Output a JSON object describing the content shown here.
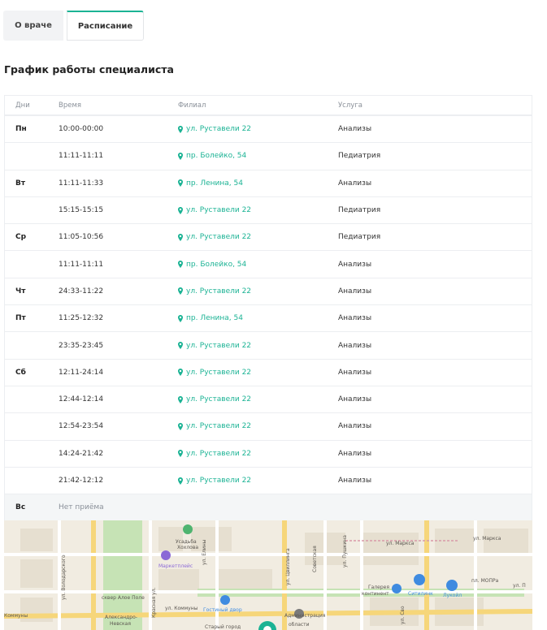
{
  "tabs": {
    "about": "О враче",
    "schedule": "Расписание"
  },
  "section_title": "График работы специалиста",
  "table": {
    "headers": {
      "day": "Дни",
      "time": "Время",
      "branch": "Филиал",
      "service": "Услуга"
    },
    "rows": [
      {
        "day": "Пн",
        "time": "10:00-00:00",
        "branch": "ул. Руставели 22",
        "service": "Анализы"
      },
      {
        "day": "",
        "time": "11:11-11:11",
        "branch": "пр. Болейко, 54",
        "service": "Педиатрия"
      },
      {
        "day": "Вт",
        "time": "11:11-11:33",
        "branch": "пр. Ленина, 54",
        "service": "Анализы"
      },
      {
        "day": "",
        "time": "15:15-15:15",
        "branch": "ул. Руставели 22",
        "service": "Педиатрия"
      },
      {
        "day": "Ср",
        "time": "11:05-10:56",
        "branch": "ул. Руставели 22",
        "service": "Педиатрия"
      },
      {
        "day": "",
        "time": "11:11-11:11",
        "branch": "пр. Болейко, 54",
        "service": "Анализы"
      },
      {
        "day": "Чт",
        "time": "24:33-11:22",
        "branch": "ул. Руставели 22",
        "service": "Анализы"
      },
      {
        "day": "Пт",
        "time": "11:25-12:32",
        "branch": "пр. Ленина, 54",
        "service": "Анализы"
      },
      {
        "day": "",
        "time": "23:35-23:45",
        "branch": "ул. Руставели 22",
        "service": "Анализы"
      },
      {
        "day": "Сб",
        "time": "12:11-24:14",
        "branch": "ул. Руставели 22",
        "service": "Анализы"
      },
      {
        "day": "",
        "time": "12:44-12:14",
        "branch": "ул. Руставели 22",
        "service": "Анализы"
      },
      {
        "day": "",
        "time": "12:54-23:54",
        "branch": "ул. Руставели 22",
        "service": "Анализы"
      },
      {
        "day": "",
        "time": "14:24-21:42",
        "branch": "ул. Руставели 22",
        "service": "Анализы"
      },
      {
        "day": "",
        "time": "21:42-12:12",
        "branch": "ул. Руставели 22",
        "service": "Анализы"
      }
    ],
    "empty_day": {
      "day": "Вс",
      "text": "Нет приёма"
    }
  },
  "map": {
    "labels": {
      "usadba": "Усадьба",
      "khokhlova": "Хохлова",
      "marketplace": "Маркетплейс",
      "ul_eliny": "ул. Елины",
      "ul_tsvillinga": "ул. Цвиллинга",
      "sovetskaya": "Советская",
      "ul_pushkina": "ул. Пушкина",
      "ul_marksa": "ул. Маркса",
      "ul_marksa_2": "ул. Маркса",
      "ul_tsvetkov": "ул. Цвиллинга",
      "ul_volodarskogo": "ул. Володарского",
      "skver": "сквер Алое Поле",
      "krasnaya": "Красная ул.",
      "kommuny": "ул. Коммуны",
      "gostiny": "Гостиный двор",
      "galereya": "Галерея",
      "kontinent": "континент",
      "citilink": "Ситилинк",
      "lukoil": "Лукойл",
      "mopra": "пл. МОПРа",
      "ul_p": "ул. П",
      "ul_sv": "ул. Сво",
      "admin": "Администрация",
      "oblasti": "области",
      "stary_gorod": "Старый город",
      "nevskaya": "Александро-",
      "nevskaya2": "Невская",
      "kommuny_left": "Коммуны"
    },
    "colors": {
      "road": "#f6d67a",
      "park": "#c6e3b5",
      "accent": "#1bb394",
      "poi_blue": "#3f8be0",
      "poi_purple": "#8b69d6"
    }
  }
}
